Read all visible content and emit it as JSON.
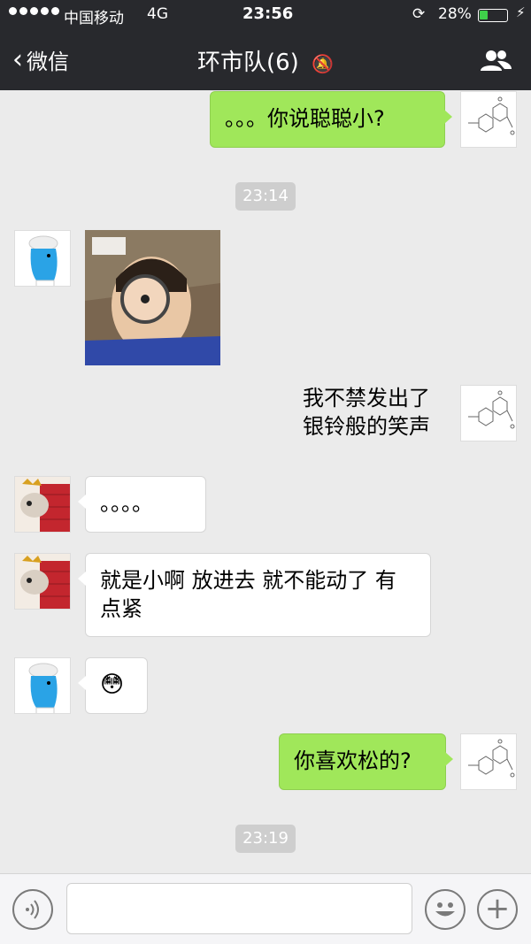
{
  "status": {
    "carrier": "中国移动",
    "network": "4G",
    "time": "23:56",
    "battery": "28%",
    "battery_level": 0.28
  },
  "nav": {
    "back_label": "微信",
    "title": "环市队(6)"
  },
  "messages": {
    "m1": "。。。你说聪聪小?",
    "t1": "23:14",
    "m3_line1": "我不禁发出了",
    "m3_line2": "银铃般的笑声",
    "m4": "。。。。",
    "m5_line1": "就是小啊 放进去 就不能动了 有",
    "m5_line2": "点紧",
    "m6_emoji": "😳",
    "m7": "你喜欢松的?",
    "t2": "23:19"
  },
  "input": {
    "placeholder": ""
  },
  "colors": {
    "header_bg": "#28292d",
    "my_bubble": "#a0e75a",
    "chat_bg": "#ebebeb"
  }
}
